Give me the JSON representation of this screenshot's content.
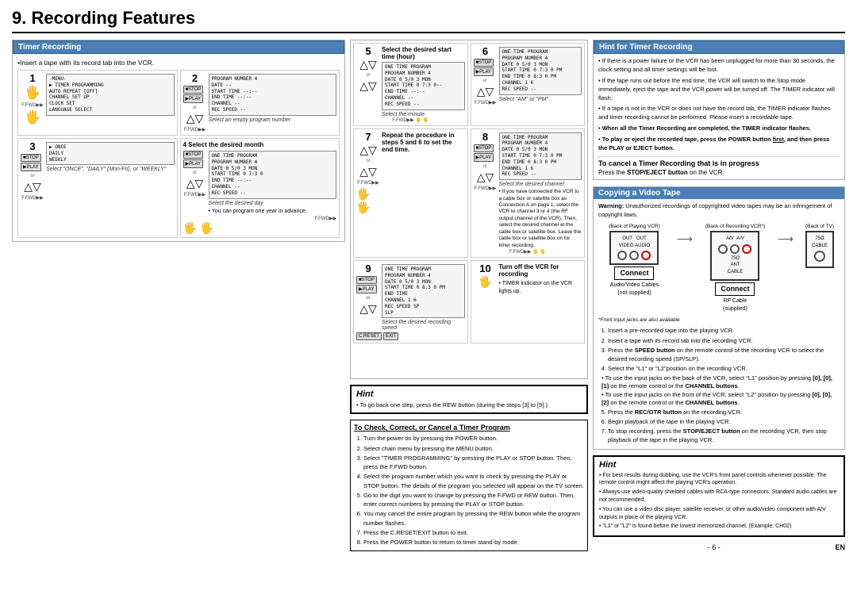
{
  "title": "9. Recording Features",
  "timer_recording": {
    "header": "Timer Recording",
    "insert_tape": "•Insert a tape with its record tab into the VCR.",
    "steps": [
      {
        "number": "1",
        "title": "",
        "menu_items": [
          "-MENU-",
          "TIMER PROGRAMMING",
          "AUTO REPEAT [OFF]",
          "CHANNEL SET UP",
          "CLOCK SET",
          "LANGUAGE SELECT"
        ],
        "desc": ""
      },
      {
        "number": "2",
        "screen": [
          "PROGRAM NUMBER  4",
          "DATE         --",
          "START TIME   -- : --",
          "END   TIME   -- : --",
          "CHANNEL      --",
          "REC SPEED    --"
        ],
        "desc": "Select an empty program number"
      },
      {
        "number": "3",
        "options": [
          "ONCE",
          "DAILY",
          "WEEKLY"
        ],
        "desc": "Select \"ONCE\", \"DAILY\" (Mon-Fri), or \"WEEKLY\""
      },
      {
        "number": "4",
        "title": "Select the desired month",
        "screen": [
          "PROGRAM NUMBER  4",
          "DATE       0 5 / 0 3  MON",
          "START TIME  0 7 : 3 0",
          "END   TIME  -- : --",
          "CHANNEL     --",
          "REC SPEED   --"
        ],
        "desc": "Select the desired day",
        "note": "• You can program one year in advance."
      }
    ],
    "steps_right": [
      {
        "number": "5",
        "title": "Select the desired start time (hour)",
        "sub": "Select the minute"
      },
      {
        "number": "6",
        "screen": [
          "PROGRAM NUMBER  4",
          "DATE       0 5 / 0 3  MON",
          "START TIME  0 7 : 3 0  PM",
          "END   TIME  0 8 : 3 0  PM",
          "CHANNEL     1  6",
          "REC SPEED   --"
        ],
        "desc": "Select \"AM\" or \"PM\""
      },
      {
        "number": "7",
        "title": "Repeat the procedure in steps 5 and 6 to set the end time."
      },
      {
        "number": "8",
        "screen": [
          "PROGRAM NUMBER  4",
          "DATE       0 5 / 0 3  MON",
          "START TIME  0 7 : 3 0  PM",
          "END   TIME  0 8 : 3 0  PM",
          "CHANNEL     1  6",
          "REC SPEED   --"
        ],
        "desc": "Select the desired channel",
        "note": "• If you have connected the VCR to a cable box or satellite box as Connection A on page 1, select the VCR to channel 3 or 4 (the RF output channel of the VCR). Then, select the desired channel at the cable box or satellite box. Leave the cable box or satellite box on for timer recording."
      }
    ],
    "steps_far_right": [
      {
        "number": "9",
        "screen": [
          "ONE TIME PROGRAM",
          "PROGRAM NUMBER  4",
          "DATE       0 5 / 0 3  MON",
          "START TIME  0 8 : 3 0  PM",
          "END   TIME",
          "CHANNEL     1  6",
          "REC SPEED   SP",
          "             SLP"
        ],
        "desc": "Select the desired recording speed"
      },
      {
        "number": "10",
        "title": "Turn off the VCR for recording",
        "note": "• TIMER indicator on the VCR lights up."
      }
    ]
  },
  "hint": {
    "title": "Hint",
    "items": [
      "To go back one step, press the REW button (during the steps [3] to [9].)"
    ]
  },
  "check_section": {
    "title": "To Check, Correct, or Cancel a Timer Program",
    "steps": [
      "Turn the power on by pressing the POWER button.",
      "Select chain menu by pressing the MENU button.",
      "Select \"TIMER PROGRAMMING\" by pressing the PLAY or STOP button. Then, press the F.FWD button.",
      "Select the program number which you want to check by pressing the PLAY or STOP button. The details of the program you selected will appear on the TV screen.",
      "Go to the digit you want to change by pressing the F.FWD or REW button. Then, enter correct numbers by pressing the PLAY or STOP button.",
      "You may cancel the entire program by pressing the REW button while the program number flashes.",
      "Press the C.RESET/EXIT button to exit.",
      "Press the POWER button to return to timer stand-by mode."
    ]
  },
  "hint_for_timer": {
    "header": "Hint for Timer Recording",
    "items": [
      "If there is a power failure or the VCR has been unplugged for more than 30 seconds, the clock setting and all timer settings will be lost.",
      "If the tape runs out before the end time, the VCR will switch to the Stop mode immediately, eject the tape and the VCR power will be turned off. The TIMER indicator will flash.",
      "If a tape is not in the VCR or does not have the record tab, the TIMER indicator flashes and timer recording cannot be performed. Please insert a recordable tape.",
      "When all the Timer Recording are completed, the TIMER indicator flashes.",
      "To play or eject the recorded tape, press the POWER button first, and then press the PLAY or EJECT button."
    ],
    "bold_item": "When all the Timer Recording are completed, the TIMER indicator flashes.",
    "bold_item2": "To play or eject the recorded tape, press the POWER button first, and then press the PLAY or EJECT button."
  },
  "cancel_timer": {
    "title": "To cancel a Timer Recording that is in progress",
    "text": "Press the STOP/EJECT button on the VCR."
  },
  "copying": {
    "header": "Copying a Video Tape",
    "warning": "Warning: Unauthorized recordings of copyrighted video tapes may be an infringement of copyright laws.",
    "labels": {
      "back_playing": "Back of Playing VCR",
      "back_recording": "Back of Recording VCR*",
      "back_tv": "Back of TV",
      "connect1": "Connect",
      "connect2": "Connect",
      "audio_video_cables": "Audio/Video Cables (not supplied)",
      "rf_cable": "RF Cable (supplied)",
      "front_note": "*Front input jacks are also available"
    },
    "steps": [
      "Insert a pre-recorded tape into the playing VCR.",
      "Insert a tape with its record tab into the recording VCR.",
      "Press the SPEED button on the remote control of the recording VCR to select the desired recording speed (SP/SLP).",
      "Select the \"L1\" or \"L2\" position on the recording VCR.",
      "• To use the input jacks on the back of the VCR, select \"L1\" position by pressing [0], [0], [1] on the remote control or the CHANNEL buttons.",
      "• To use the input jacks on the front of the VCR, select \"L2\" position by pressing [0], [0], [2] on the remote control or the CHANNEL buttons.",
      "Press the REC/OTR button on the recording VCR.",
      "Begin playback of the tape in the playing VCR.",
      "To stop recording, press the STOP/EJECT button on the recording VCR, then stop playback of the tape in the playing VCR."
    ]
  },
  "hint_bottom": {
    "title": "Hint",
    "items": [
      "For best results during dubbing, use the VCR's front panel controls whenever possible. The remote control might affect the playing VCR's operation.",
      "Always use video-quality shielded cables with RCA-type connectors. Standard audio cables are not recommended.",
      "You can use a video disc player, satellite receiver, or other audio/video component with A/V outputs in place of the playing VCR.",
      "\"L1\" or \"L2\" is found before the lowest memorized channel. (Example: CH02)"
    ]
  },
  "page_number": "- 6 -",
  "en_label": "EN"
}
